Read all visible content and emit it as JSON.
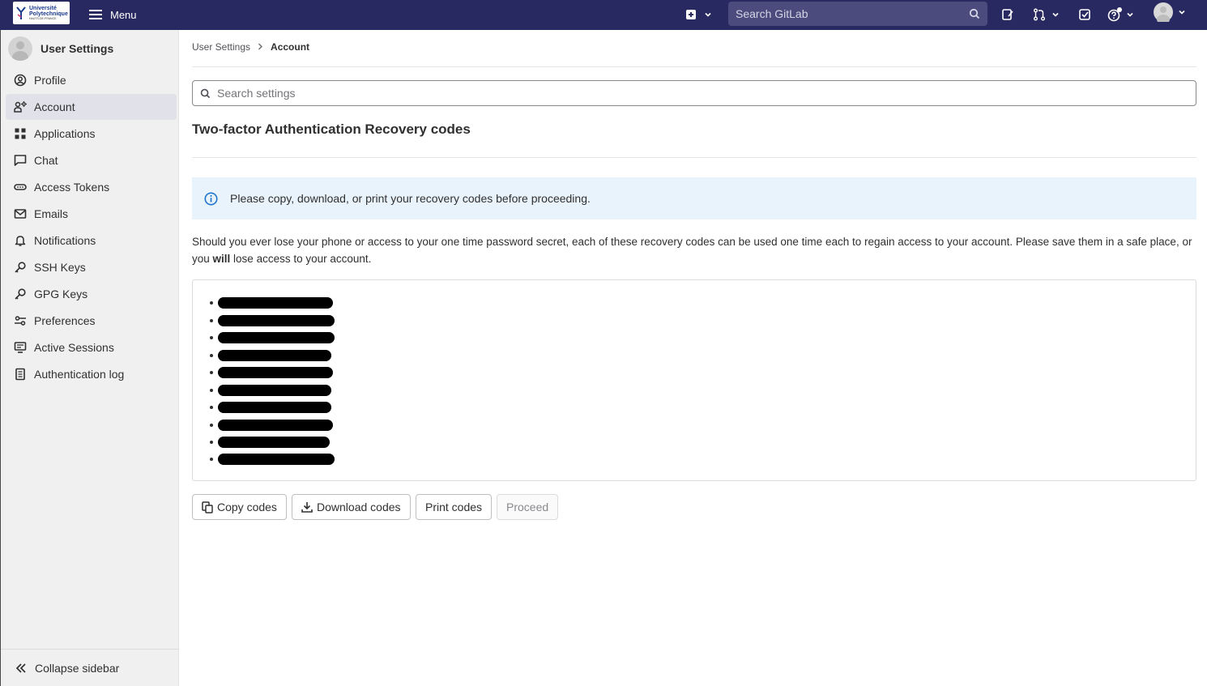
{
  "topbar": {
    "logo": {
      "line1": "Université",
      "line2": "Polytechnique",
      "line3": "HAUTS-DE-FRANCE"
    },
    "menu_label": "Menu",
    "search_placeholder": "Search GitLab",
    "icons": [
      "plus-square-icon",
      "chevron-down-icon",
      "search-icon",
      "issues-icon",
      "merge-request-icon",
      "todo-icon",
      "help-icon",
      "avatar-icon"
    ]
  },
  "sidebar": {
    "title": "User Settings",
    "items": [
      {
        "label": "Profile",
        "icon": "profile-icon"
      },
      {
        "label": "Account",
        "icon": "account-icon",
        "active": true
      },
      {
        "label": "Applications",
        "icon": "applications-icon"
      },
      {
        "label": "Chat",
        "icon": "chat-icon"
      },
      {
        "label": "Access Tokens",
        "icon": "token-icon"
      },
      {
        "label": "Emails",
        "icon": "mail-icon"
      },
      {
        "label": "Notifications",
        "icon": "bell-icon"
      },
      {
        "label": "SSH Keys",
        "icon": "key-icon"
      },
      {
        "label": "GPG Keys",
        "icon": "key-icon"
      },
      {
        "label": "Preferences",
        "icon": "preferences-icon"
      },
      {
        "label": "Active Sessions",
        "icon": "monitor-icon"
      },
      {
        "label": "Authentication log",
        "icon": "log-icon"
      }
    ],
    "collapse_label": "Collapse sidebar"
  },
  "breadcrumb": {
    "parent": "User Settings",
    "current": "Account"
  },
  "settings_search_placeholder": "Search settings",
  "page_title": "Two-factor Authentication Recovery codes",
  "alert_text": "Please copy, download, or print your recovery codes before proceeding.",
  "description": {
    "before": "Should you ever lose your phone or access to your one time password secret, each of these recovery codes can be used one time each to regain access to your account. Please save them in a safe place, or you ",
    "bold": "will",
    "after": " lose access to your account."
  },
  "recovery_codes_count": 10,
  "buttons": {
    "copy": "Copy codes",
    "download": "Download codes",
    "print": "Print codes",
    "proceed": "Proceed"
  },
  "colors": {
    "topbar": "#292961",
    "sidebar": "#f0f0f0",
    "active_item": "#e1e1e9",
    "alert": "#e9f3fc",
    "info_icon": "#1f75cb"
  }
}
